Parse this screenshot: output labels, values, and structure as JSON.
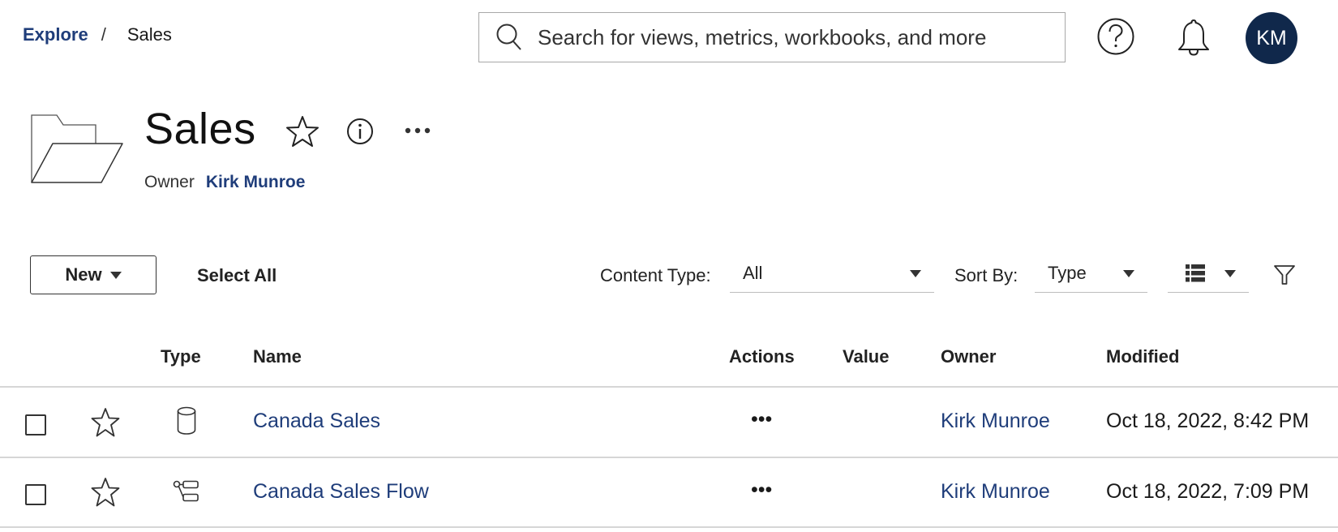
{
  "breadcrumb": {
    "items": [
      {
        "label": "Explore",
        "link": true
      },
      {
        "label": "Sales",
        "link": false
      }
    ],
    "separator": "/"
  },
  "search": {
    "placeholder": "Search for views, metrics, workbooks, and more",
    "value": ""
  },
  "topbar": {
    "help_icon": "question-circle-icon",
    "notifications_icon": "bell-icon",
    "avatar_initials": "KM",
    "avatar_color": "#10284b"
  },
  "header": {
    "icon": "folder-open-icon",
    "title": "Sales",
    "owner_label": "Owner",
    "owner_name": "Kirk Munroe",
    "actions": [
      "favorite-star-icon",
      "info-icon",
      "more-actions-icon"
    ]
  },
  "toolbar": {
    "new_label": "New",
    "select_all_label": "Select All",
    "content_type_label": "Content Type:",
    "content_type_value": "All",
    "sort_by_label": "Sort By:",
    "sort_by_value": "Type",
    "view_mode_icon": "list-view-icon",
    "filter_icon": "filter-icon"
  },
  "table": {
    "columns": [
      "Type",
      "Name",
      "Actions",
      "Value",
      "Owner",
      "Modified"
    ],
    "rows": [
      {
        "checked": false,
        "favorite": false,
        "type_icon": "data-source-cylinder-icon",
        "name": "Canada Sales",
        "actions": "•••",
        "value": "",
        "owner": "Kirk Munroe",
        "modified": "Oct 18, 2022, 8:42 PM"
      },
      {
        "checked": false,
        "favorite": false,
        "type_icon": "flow-icon",
        "name": "Canada Sales Flow",
        "actions": "•••",
        "value": "",
        "owner": "Kirk Munroe",
        "modified": "Oct 18, 2022, 7:09 PM"
      }
    ]
  },
  "colors": {
    "link": "#1f3d7a",
    "text": "#1a1a1a",
    "divider": "#d6d6d6"
  }
}
